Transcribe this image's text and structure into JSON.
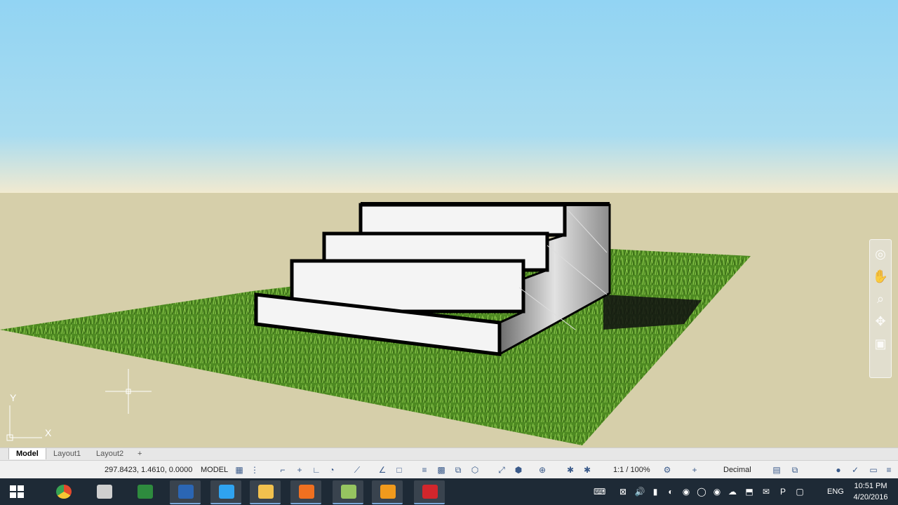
{
  "viewport": {
    "colors": {
      "sky_top": "#92d4f3",
      "sky_bottom": "#f2ead0",
      "ground": "#d6cfaa",
      "grass": "#4e8a22",
      "step_face": "#ffffff",
      "step_edge": "#000000",
      "side": "#9a9a9a"
    }
  },
  "navbar": {
    "items": [
      {
        "icon": "steering-wheel-icon"
      },
      {
        "icon": "pan-hand-icon"
      },
      {
        "icon": "zoom-icon"
      },
      {
        "icon": "orbit-icon"
      },
      {
        "icon": "showmotion-icon"
      }
    ]
  },
  "layout_tabs": [
    {
      "label": "Model",
      "active": true
    },
    {
      "label": "Layout1",
      "active": false
    },
    {
      "label": "Layout2",
      "active": false
    },
    {
      "label": "+",
      "active": false
    }
  ],
  "status": {
    "coordinates": "297.8423, 1.4610, 0.0000",
    "space": "MODEL",
    "scale": "1:1 / 100%",
    "units": "Decimal",
    "icons": [
      "grid-icon",
      "snap-icon",
      "infer-icon",
      "dynamic-input-icon",
      "ortho-icon",
      "polar-icon",
      "isodraft-icon",
      "object-snap-tracking-icon",
      "2d-osnap-icon",
      "lineweight-icon",
      "transparency-icon",
      "selection-cycling-icon",
      "3d-osnap-icon",
      "dynamic-ucs-icon",
      "selection-filter-icon",
      "gizmo-icon",
      "annotation-visibility-icon",
      "auto-scale-icon",
      "workspace-icon",
      "plus-icon",
      "quick-properties-icon",
      "isolate-objects-icon",
      "hardware-accel-icon",
      "clean-screen-icon",
      "customize-icon"
    ]
  },
  "taskbar": {
    "apps": [
      {
        "name": "windows-start-icon",
        "color": "#ffffff"
      },
      {
        "name": "chrome-icon",
        "color": "#e4492c"
      },
      {
        "name": "camera-icon",
        "color": "#cfcfcf"
      },
      {
        "name": "app-green-icon",
        "color": "#2e8b3e"
      },
      {
        "name": "revit-icon",
        "color": "#2b66b4"
      },
      {
        "name": "photoshop-icon",
        "color": "#2fa3f0"
      },
      {
        "name": "file-explorer-icon",
        "color": "#f2c14e"
      },
      {
        "name": "pdf-reader-icon",
        "color": "#f07020"
      },
      {
        "name": "sketchup-layout-icon",
        "color": "#96c460"
      },
      {
        "name": "media-player-icon",
        "color": "#f19a1c"
      },
      {
        "name": "autocad-icon",
        "color": "#d2262c"
      }
    ],
    "tray": [
      "keyboard-icon",
      "xampp-icon",
      "volume-icon",
      "network-signal-icon",
      "antivirus-icon",
      "chrome-tray-icon",
      "globe-icon",
      "chrome-tray2-icon",
      "cloud-icon",
      "usb-icon",
      "message-icon",
      "pushbullet-icon",
      "display-icon"
    ],
    "language": "ENG",
    "time": "10:51 PM",
    "date": "4/20/2016"
  },
  "ucs": {
    "x_label": "X",
    "y_label": "Y"
  }
}
